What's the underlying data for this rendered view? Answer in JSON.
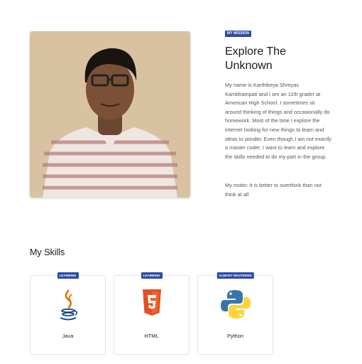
{
  "profile_photo": {
    "alt": "Portrait photo"
  },
  "mission": {
    "badge": "MY MISSION",
    "title": "Explore The Unknown",
    "bio": "My name is Karthikeya Shreyas Kambhampati and I am an 11th grader at American High School. I sometimes sit around thinking of things and occasionally do homework. Most of the time I explore the internet looking for new things to learn and ideas to ponder. Even though I am not exactly a master coder, I want to learn and explore the skills needed to do my part in the group.",
    "motto": "My motto: It is better to overthink than not think at all"
  },
  "skills": {
    "heading": "My Skills",
    "items": [
      {
        "badge": "LEARNING",
        "name": "Java",
        "icon": "java-icon"
      },
      {
        "badge": "LEARNING",
        "name": "HTML",
        "icon": "html5-icon"
      },
      {
        "badge": "ALMOST MASTERED",
        "name": "Python",
        "icon": "python-icon"
      }
    ]
  },
  "colors": {
    "badge_bg": "#2c4aa5",
    "html_orange": "#e44d26",
    "python_blue": "#3776ab",
    "python_yellow": "#ffd43b",
    "java_blue": "#0f4a8a",
    "java_orange": "#e76f00"
  }
}
